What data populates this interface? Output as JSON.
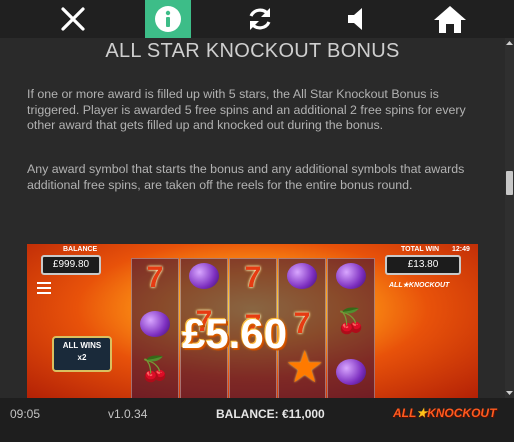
{
  "topbar": {
    "icons": [
      "close-icon",
      "info-icon",
      "refresh-icon",
      "speaker-icon",
      "home-icon"
    ],
    "active_icon": "info-icon",
    "active_color": "#3dbd88"
  },
  "help": {
    "title": "ALL STAR KNOCKOUT BONUS",
    "paragraph1": "If one or more award is filled up with 5 stars, the All Star Knockout Bonus is triggered. Player is awarded 5 free spins and an additional 2 free spins for every other award that gets filled up and knocked out during the bonus.",
    "paragraph2": "Any award symbol that starts the bonus and any additional symbols that awards additional free spins, are taken off the reels for the entire bonus round."
  },
  "game_preview": {
    "balance_label": "BALANCE",
    "balance_value": "£999.80",
    "total_win_label": "TOTAL WIN",
    "clock": "12:49",
    "total_win_value": "£13.80",
    "logo_text": "ALL★KNOCKOUT",
    "all_wins_label": "ALL WINS",
    "all_wins_multiplier": "x2",
    "win_amount": "£5.60",
    "symbols": [
      "seven",
      "plum",
      "cherry"
    ]
  },
  "bottombar": {
    "time": "09:05",
    "version": "v1.0.34",
    "balance": "BALANCE: €11,000",
    "logo_left": "ALL",
    "logo_star": "★",
    "logo_right": "KNOCKOUT"
  }
}
